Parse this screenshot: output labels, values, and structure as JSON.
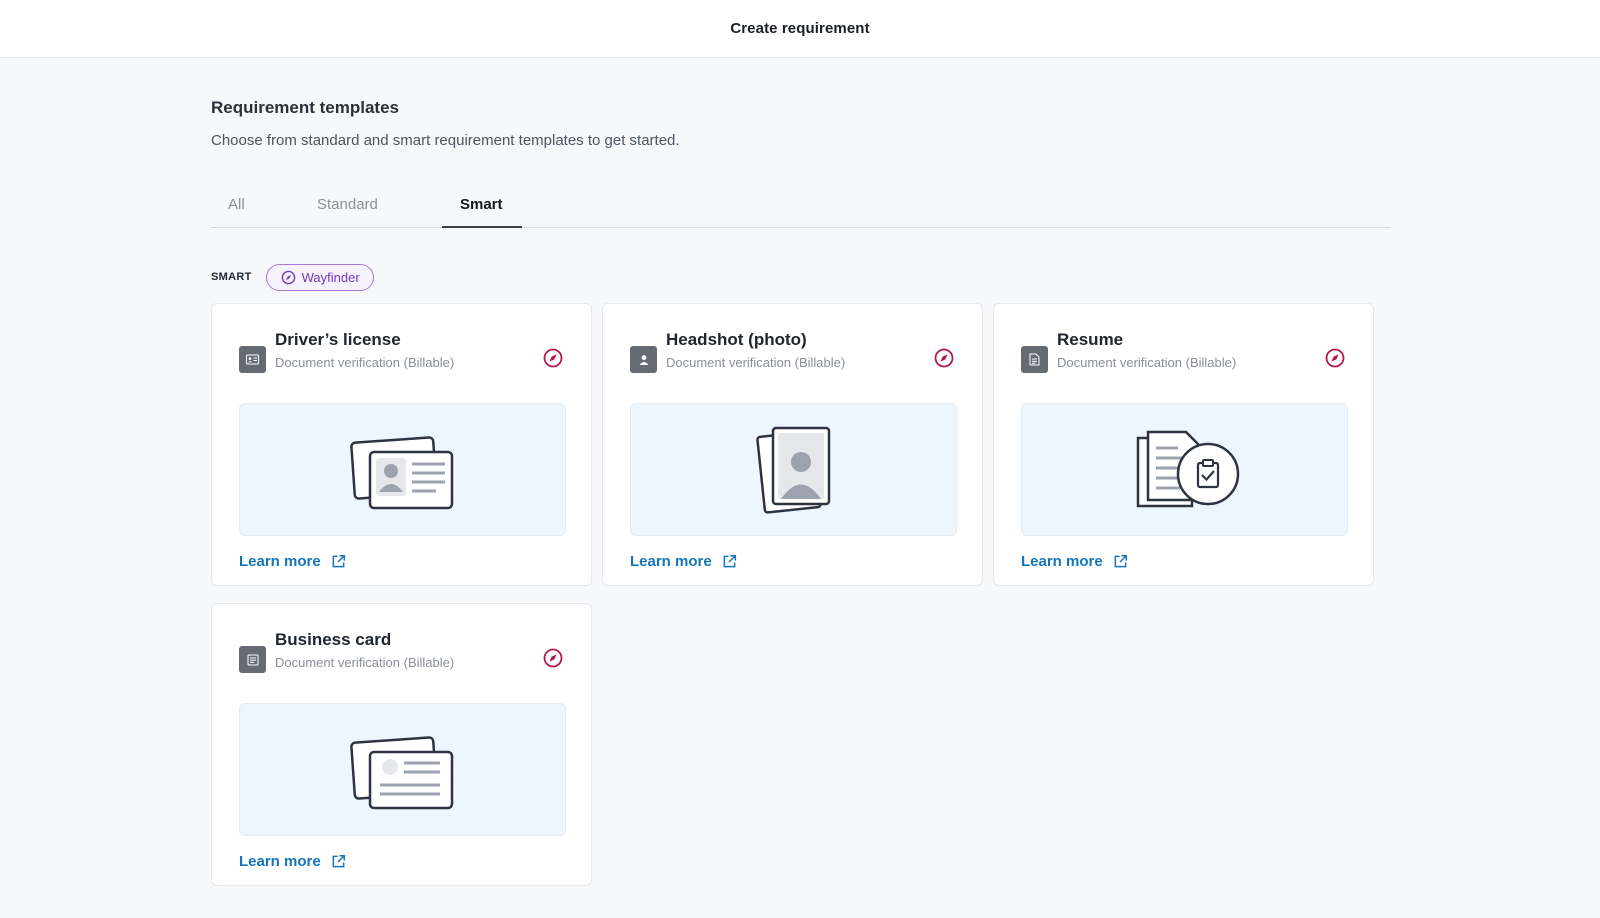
{
  "header": {
    "title": "Create requirement"
  },
  "section": {
    "title": "Requirement templates",
    "subtitle": "Choose from standard and smart requirement templates to get started."
  },
  "tabs": [
    {
      "label": "All",
      "active": false
    },
    {
      "label": "Standard",
      "active": false
    },
    {
      "label": "Smart",
      "active": true
    }
  ],
  "filter": {
    "label": "SMART",
    "chip_label": "Wayfinder",
    "chip_icon": "compass-icon",
    "chip_color": "#7238b8"
  },
  "cards": [
    {
      "title": "Driver’s license",
      "subtitle": "Document verification (Billable)",
      "icon": "id-card-icon",
      "illustration": "drivers-license-illustration",
      "link": "Learn more"
    },
    {
      "title": "Headshot (photo)",
      "subtitle": "Document verification (Billable)",
      "icon": "person-icon",
      "illustration": "headshot-illustration",
      "link": "Learn more"
    },
    {
      "title": "Resume",
      "subtitle": "Document verification (Billable)",
      "icon": "document-icon",
      "illustration": "resume-illustration",
      "link": "Learn more"
    },
    {
      "title": "Business card",
      "subtitle": "Document verification (Billable)",
      "icon": "card-icon",
      "illustration": "business-card-illustration",
      "link": "Learn more"
    }
  ],
  "colors": {
    "accent": "#1576b8",
    "compass": "#b5174b",
    "chip": "#7238b8",
    "illustration_bg": "#eef6fd"
  }
}
